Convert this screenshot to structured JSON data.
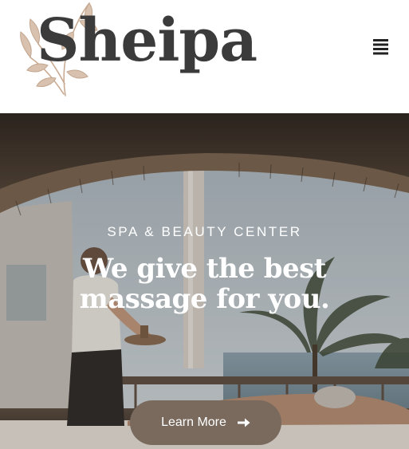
{
  "site": {
    "brand_name": "Sheipa",
    "menu_icon": "hamburger-menu-icon"
  },
  "hero": {
    "eyebrow": "SPA & BEAUTY CENTER",
    "title": "We give the best massage for you.",
    "cta_label": "Learn More",
    "cta_icon": "arrow-right-icon"
  },
  "colors": {
    "logo_text": "#3b3b3b",
    "logo_leaves": "#c9ab93",
    "cta_background": "#7a6a5e",
    "hero_text": "#ffffff"
  }
}
